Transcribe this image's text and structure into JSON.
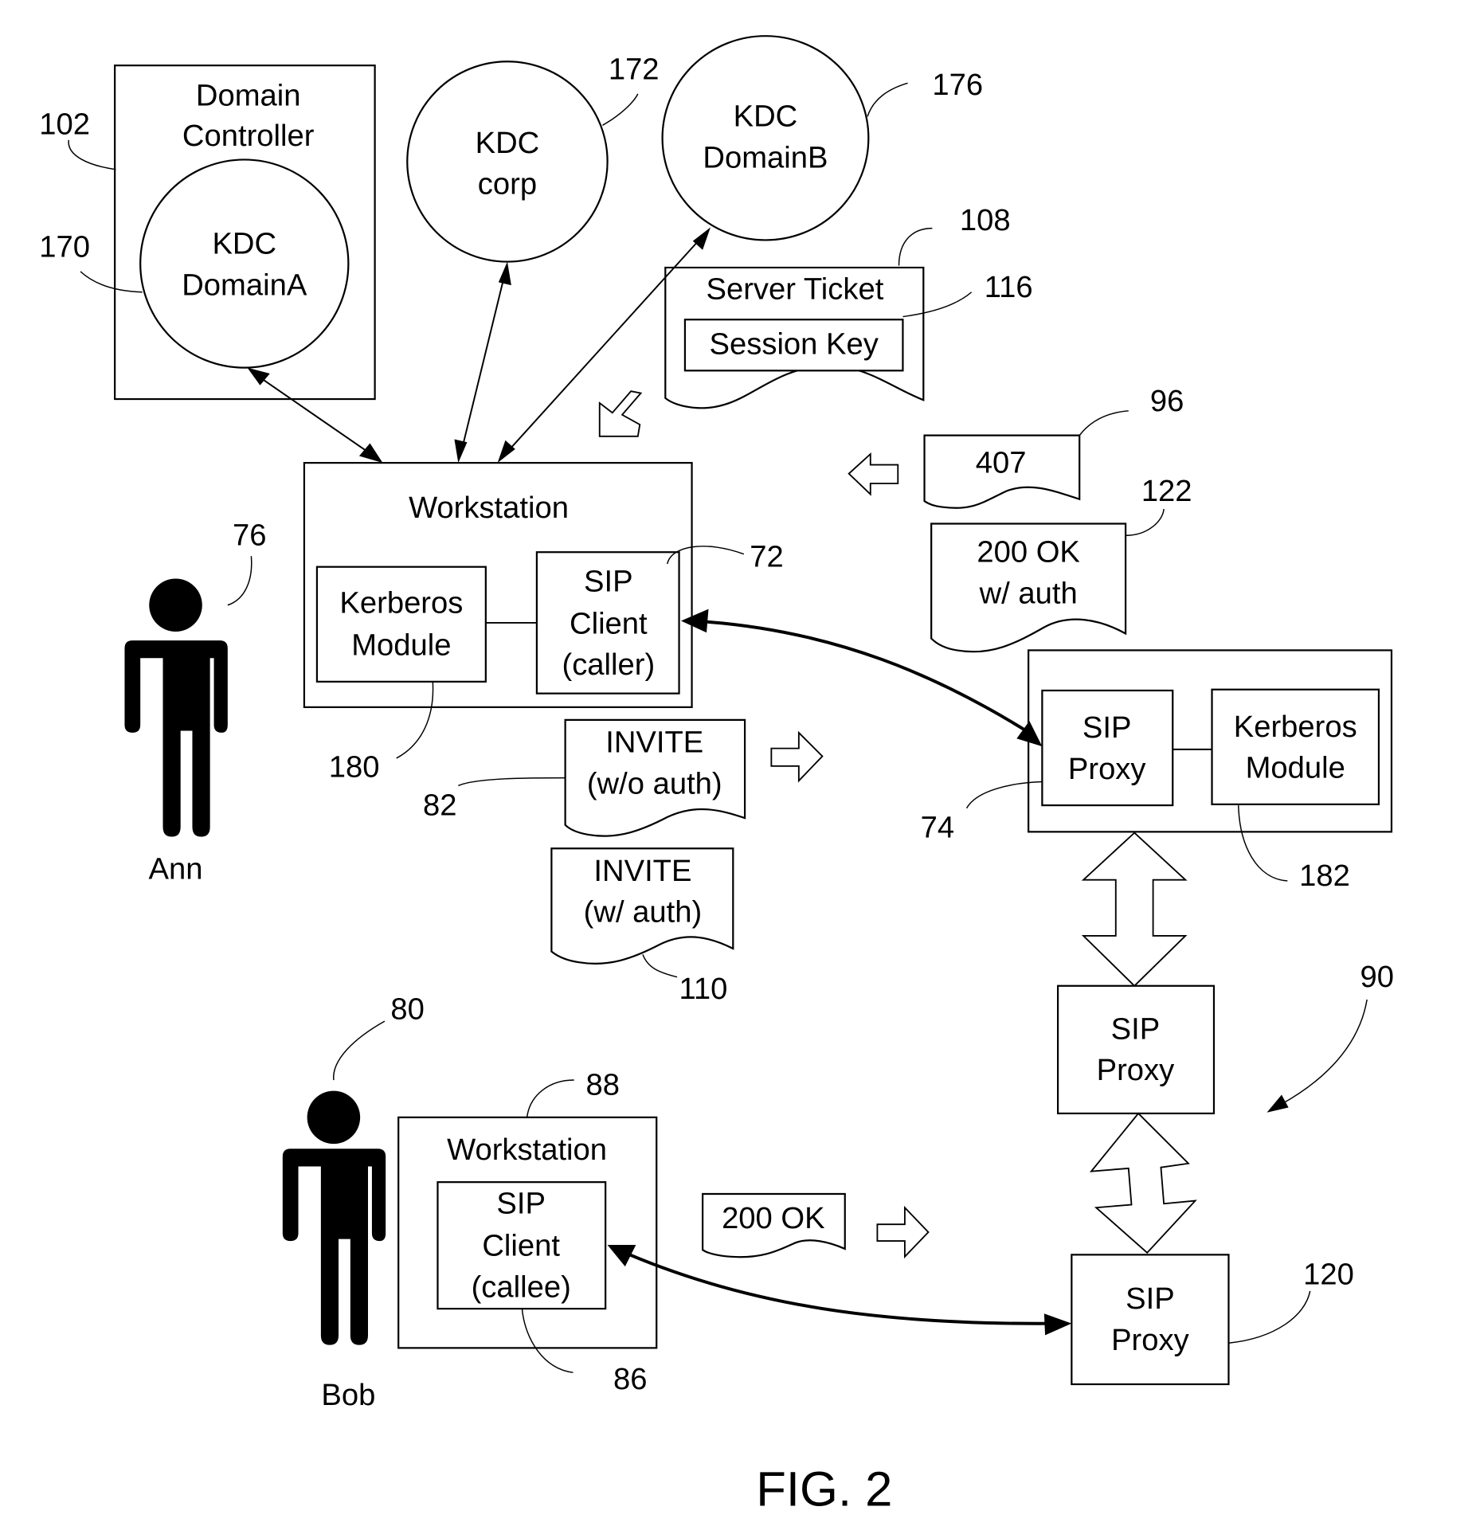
{
  "figure": {
    "caption": "FIG. 2",
    "diagram_ref": "90"
  },
  "nodes": {
    "domain_controller": {
      "title_line1": "Domain",
      "title_line2": "Controller",
      "ref": "102"
    },
    "kdc_domain_a": {
      "line1": "KDC",
      "line2": "DomainA",
      "ref": "170"
    },
    "kdc_corp": {
      "line1": "KDC",
      "line2": "corp",
      "ref": "172"
    },
    "kdc_domain_b": {
      "line1": "KDC",
      "line2": "DomainB",
      "ref": "176"
    },
    "server_ticket": {
      "title": "Server Ticket",
      "ref": "108",
      "session_key": "Session Key",
      "session_key_ref": "116"
    },
    "caller_workstation": {
      "title": "Workstation",
      "kerberos_line1": "Kerberos",
      "kerberos_line2": "Module",
      "kerberos_ref": "180",
      "sip_line1": "SIP",
      "sip_line2": "Client",
      "sip_line3": "(caller)",
      "sip_ref": "72"
    },
    "ann": {
      "name": "Ann",
      "ref": "76"
    },
    "bob": {
      "name": "Bob",
      "ref": "80"
    },
    "callee_workstation": {
      "title": "Workstation",
      "ref": "88",
      "sip_line1": "SIP",
      "sip_line2": "Client",
      "sip_line3": "(callee)",
      "sip_ref": "86"
    },
    "proxy_74": {
      "sip_line1": "SIP",
      "sip_line2": "Proxy",
      "ref": "74",
      "kerberos_line1": "Kerberos",
      "kerberos_line2": "Module",
      "kerberos_ref": "182"
    },
    "proxy_middle": {
      "line1": "SIP",
      "line2": "Proxy"
    },
    "proxy_120": {
      "line1": "SIP",
      "line2": "Proxy",
      "ref": "120"
    }
  },
  "messages": {
    "m407": {
      "text": "407",
      "ref": "96"
    },
    "ok_auth": {
      "line1": "200 OK",
      "line2": "w/ auth",
      "ref": "122"
    },
    "invite_noauth": {
      "line1": "INVITE",
      "line2": "(w/o auth)",
      "ref": "82"
    },
    "invite_auth": {
      "line1": "INVITE",
      "line2": "(w/ auth)",
      "ref": "110"
    },
    "ok_plain": {
      "text": "200 OK"
    }
  }
}
